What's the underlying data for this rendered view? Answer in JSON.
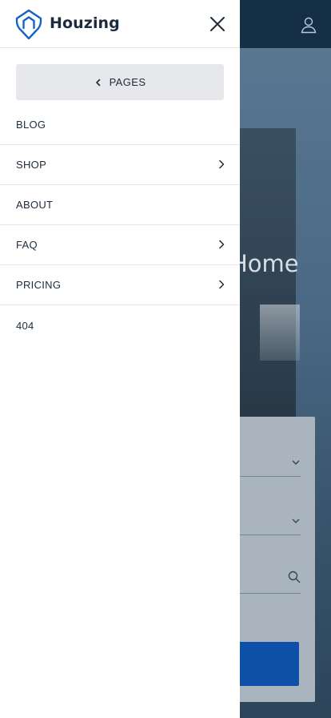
{
  "brand": {
    "name": "Houzing",
    "accent": "#1563c6"
  },
  "drawer": {
    "back_label": "PAGES",
    "items": [
      {
        "label": "BLOG",
        "has_submenu": false
      },
      {
        "label": "SHOP",
        "has_submenu": true
      },
      {
        "label": "ABOUT",
        "has_submenu": false
      },
      {
        "label": "FAQ",
        "has_submenu": true
      },
      {
        "label": "PRICING",
        "has_submenu": true
      },
      {
        "label": "404",
        "has_submenu": false
      }
    ]
  },
  "background": {
    "hero_title_fragment": "Home",
    "icons": [
      "user-icon",
      "chevron-down-icon",
      "search-icon"
    ],
    "button_color": "#0e55b3"
  }
}
